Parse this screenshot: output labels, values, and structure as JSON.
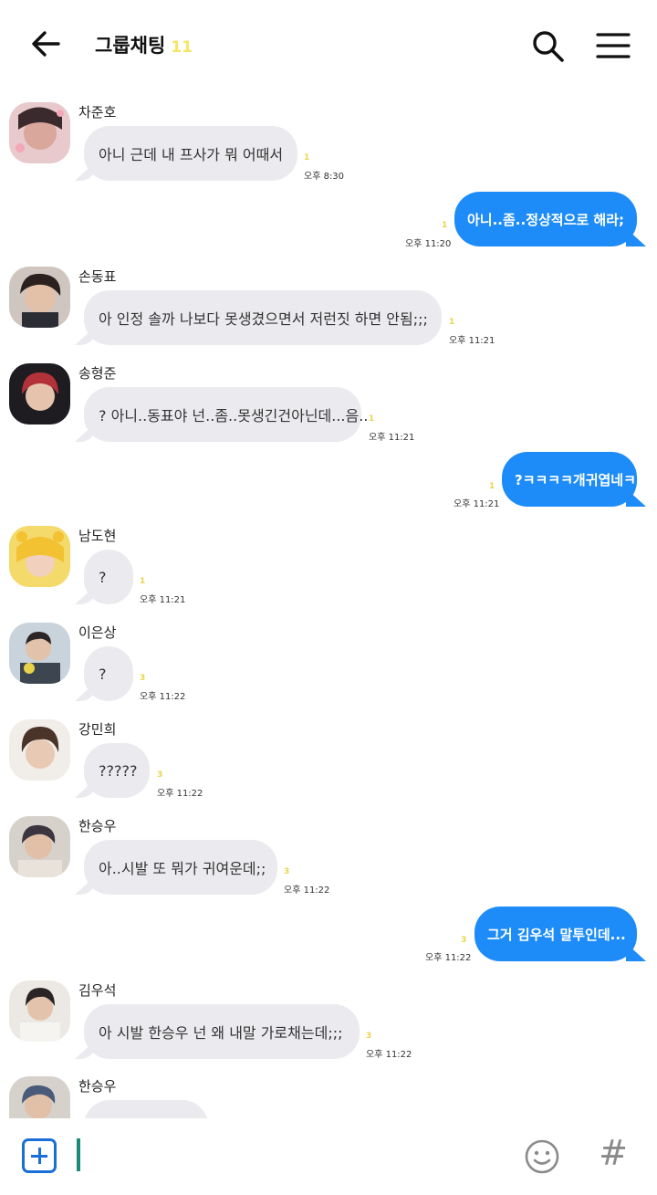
{
  "header": {
    "title": "그룹채팅",
    "member_count": "11"
  },
  "messages": [
    {
      "sender": "차준호",
      "text": "아니 근데 내 프사가 뭐 어때서",
      "unread": "1",
      "time": "오후 8:30"
    },
    {
      "text": "아니..좀..정상적으로 해라;",
      "unread": "1",
      "time": "오후 11:20"
    },
    {
      "sender": "손동표",
      "text": "아 인정 솔까 나보다 못생겼으면서 저런짓 하면 안됨;;;",
      "unread": "1",
      "time": "오후 11:21"
    },
    {
      "sender": "송형준",
      "text": "? 아니..동표야 넌..좀..못생긴건아닌데...음..",
      "unread": "1",
      "time": "오후 11:21"
    },
    {
      "text": "?ㅋㅋㅋㅋ개귀엽네ㅋ",
      "unread": "1",
      "time": "오후 11:21"
    },
    {
      "sender": "남도현",
      "text": "?",
      "unread": "1",
      "time": "오후 11:21"
    },
    {
      "sender": "이은상",
      "text": "?",
      "unread": "3",
      "time": "오후 11:22"
    },
    {
      "sender": "강민희",
      "text": "?????",
      "unread": "3",
      "time": "오후 11:22"
    },
    {
      "sender": "한승우",
      "text": "아..시발 또 뭐가 귀여운데;;",
      "unread": "3",
      "time": "오후 11:22"
    },
    {
      "text": "그거 김우석 말투인데...",
      "unread": "3",
      "time": "오후 11:22"
    },
    {
      "sender": "김우석",
      "text": "아 시발 한승우 넌 왜 내말 가로채는데;;;",
      "unread": "3",
      "time": "오후 11:22"
    },
    {
      "sender": "한승우",
      "text": ""
    }
  ],
  "colors": {
    "accent": "#1d8cf8",
    "incoming_bubble": "#ebebef",
    "unread": "#e9d44a"
  },
  "icons": {
    "back": "back-arrow-icon",
    "search": "search-icon",
    "menu": "hamburger-menu-icon",
    "add": "plus-square-icon",
    "emoji": "smiley-icon",
    "hash": "hash-icon"
  },
  "inputbar": {
    "hash_symbol": "#"
  }
}
